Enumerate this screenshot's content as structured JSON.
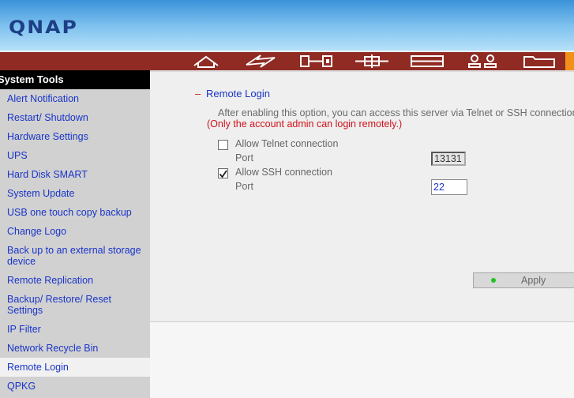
{
  "brand": {
    "logo_text": "QNAP"
  },
  "nav": {
    "icons": [
      "home-icon",
      "lightning-icon",
      "network-icon",
      "plug-icon",
      "storage-icon",
      "users-icon",
      "folder-icon"
    ]
  },
  "sidebar": {
    "title": "System Tools",
    "items": [
      {
        "label": "Alert Notification"
      },
      {
        "label": "Restart/ Shutdown"
      },
      {
        "label": "Hardware Settings"
      },
      {
        "label": "UPS"
      },
      {
        "label": "Hard Disk SMART"
      },
      {
        "label": "System Update"
      },
      {
        "label": "USB one touch copy backup"
      },
      {
        "label": "Change Logo"
      },
      {
        "label": "Back up to an external storage device"
      },
      {
        "label": "Remote Replication"
      },
      {
        "label": "Backup/ Restore/ Reset Settings"
      },
      {
        "label": "IP Filter"
      },
      {
        "label": "Network Recycle Bin"
      },
      {
        "label": "Remote Login"
      },
      {
        "label": "QPKG"
      }
    ]
  },
  "main": {
    "section_dash": "–",
    "section_title": "Remote Login",
    "description": "After enabling this option, you can access this server via Telnet or SSH connection.",
    "warning": "(Only the account admin can login remotely.)",
    "telnet": {
      "label": "Allow Telnet connection",
      "checked": false,
      "port_label": "Port",
      "port_value": "13131"
    },
    "ssh": {
      "label": "Allow SSH connection",
      "checked": true,
      "port_label": "Port",
      "port_value": "22"
    },
    "apply_label": "Apply"
  },
  "colors": {
    "nav_bar": "#8f2b23",
    "accent_orange": "#f39019",
    "link_blue": "#1a35c8",
    "warning_red": "#d0121b",
    "apply_dot": "#22c21f"
  }
}
